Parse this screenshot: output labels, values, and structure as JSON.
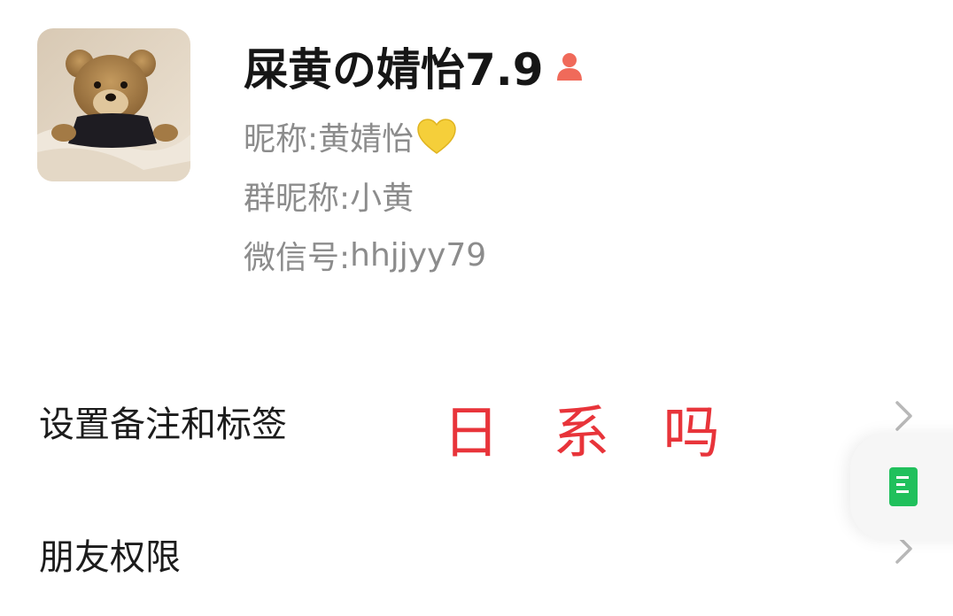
{
  "profile": {
    "display_name": "屎黄の婧怡7.9",
    "gender_icon": "female-user-icon",
    "nickname_label": "昵称: ",
    "nickname_value": "黄婧怡",
    "heart_icon": "yellow-heart-icon",
    "group_nickname_label": "群昵称: ",
    "group_nickname_value": "小黄",
    "wechat_id_label": "微信号: ",
    "wechat_id_value": "hhjjyy79"
  },
  "menu": {
    "items": [
      {
        "label": "设置备注和标签",
        "icon": "chevron-right-icon"
      },
      {
        "label": "朋友权限",
        "icon": "chevron-right-icon"
      }
    ]
  },
  "overlay": {
    "caption": "日 系 吗",
    "caption_color": "#e8343a"
  },
  "floating_widget": {
    "icon": "document-icon",
    "accent_color": "#20c05c"
  }
}
